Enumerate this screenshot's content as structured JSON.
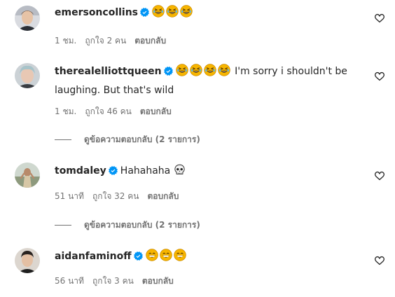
{
  "comments": [
    {
      "username": "emersoncollins",
      "verified": true,
      "emojis": [
        "rofl-emoji",
        "rofl-emoji",
        "rofl-emoji"
      ],
      "text": "",
      "time": "1 ชม.",
      "likes": "ถูกใจ 2 คน",
      "reply": "ตอบกลับ"
    },
    {
      "username": "therealelliottqueen",
      "verified": true,
      "emojis": [
        "rofl-emoji",
        "rofl-emoji",
        "rofl-emoji",
        "rofl-emoji"
      ],
      "text": "I'm sorry i shouldn't be laughing. But that's wild",
      "time": "1 ชม.",
      "likes": "ถูกใจ 46 คน",
      "reply": "ตอบกลับ",
      "view_replies": "ดูข้อความตอบกลับ (2 รายการ)"
    },
    {
      "username": "tomdaley",
      "verified": true,
      "text": "Hahahaha",
      "trailing_emoji": "skull-emoji",
      "time": "51 นาที",
      "likes": "ถูกใจ 32 คน",
      "reply": "ตอบกลับ",
      "view_replies": "ดูข้อความตอบกลับ (2 รายการ)"
    },
    {
      "username": "aidanfaminoff",
      "verified": true,
      "emojis": [
        "grin-sweat-emoji",
        "grin-sweat-emoji",
        "grin-sweat-emoji"
      ],
      "text": "",
      "time": "56 นาที",
      "likes": "ถูกใจ 3 คน",
      "reply": "ตอบกลับ"
    }
  ],
  "colors": {
    "text": "#262626",
    "secondary": "#737373",
    "verified": "#0095f6",
    "emoji": "#f7b500"
  }
}
